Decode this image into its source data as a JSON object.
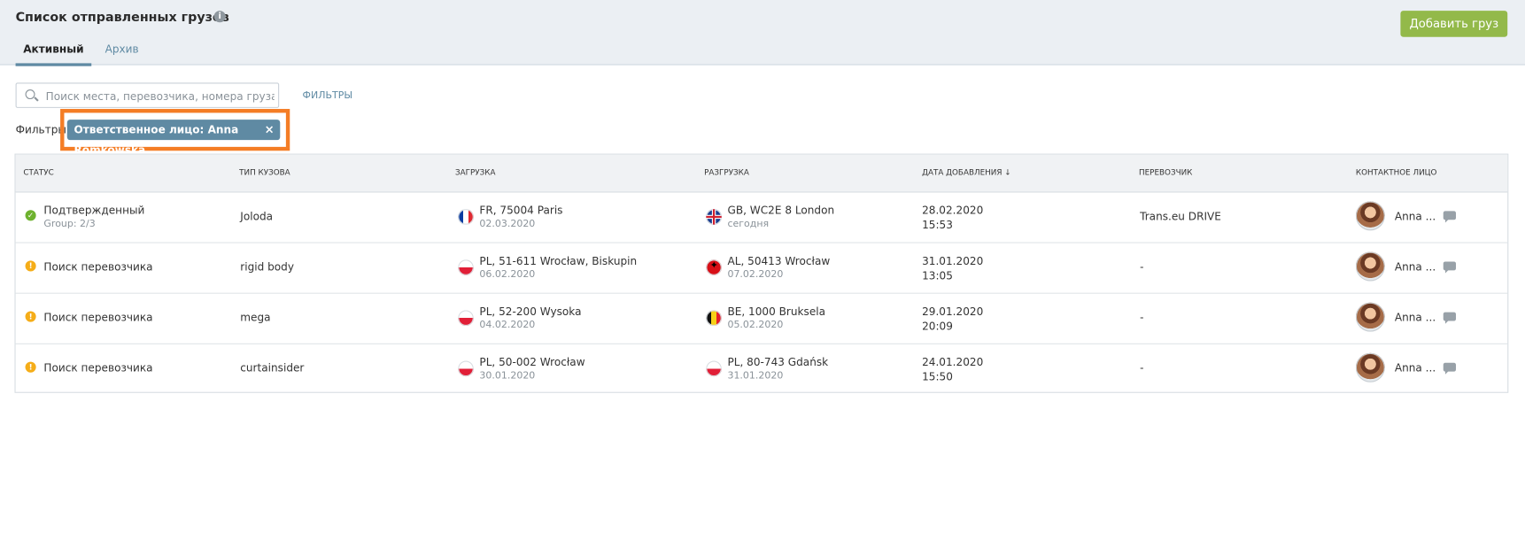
{
  "page": {
    "title": "Список отправленных грузов",
    "info_icon": "i",
    "add_button": "Добавить груз"
  },
  "tabs": [
    "Активный",
    "Архив"
  ],
  "search": {
    "placeholder": "Поиск места, перевозчика, номера груза ..."
  },
  "filters": {
    "link": "ФИЛЬТРЫ",
    "label": "Фильтры",
    "chip": "Ответственное лицо: Anna Romkowska",
    "remove": "×"
  },
  "table": {
    "headers": [
      "СТАТУС",
      "ТИП КУЗОВА",
      "ЗАГРУЗКА",
      "РАЗГРУЗКА",
      "ДАТА ДОБАВЛЕНИЯ ↓",
      "ПЕРЕВОЗЧИК",
      "КОНТАКТНОЕ ЛИЦО"
    ],
    "rows": [
      {
        "status_icon": "check-circle-icon",
        "status": "Подтвержденный",
        "status_sub": "Group: 2/3",
        "body_type": "Joloda",
        "loading": "FR, 75004 Paris",
        "loading_date": "02.03.2020",
        "loading_flag": "france-flag-icon",
        "unloading": "GB, WC2E 8 London",
        "unloading_date": "сегодня",
        "unloading_flag": "great-britain-flag-icon",
        "added_date": "28.02.2020",
        "added_time": "15:53",
        "carrier": "Trans.eu DRIVE",
        "contact": "Anna ..."
      },
      {
        "status_icon": "warning-circle-icon",
        "status": "Поиск перевозчика",
        "status_sub": "",
        "body_type": "rigid body",
        "loading": "PL, 51-611 Wrocław, Biskupin",
        "loading_date": "06.02.2020",
        "loading_flag": "poland-flag-icon",
        "unloading": "AL, 50413 Wrocław",
        "unloading_date": "07.02.2020",
        "unloading_flag": "albania-flag-icon",
        "added_date": "31.01.2020",
        "added_time": "13:05",
        "carrier": "-",
        "contact": "Anna ..."
      },
      {
        "status_icon": "warning-circle-icon",
        "status": "Поиск перевозчика",
        "status_sub": "",
        "body_type": "mega",
        "loading": "PL, 52-200 Wysoka",
        "loading_date": "04.02.2020",
        "loading_flag": "poland-flag-icon",
        "unloading": "BE, 1000 Bruksela",
        "unloading_date": "05.02.2020",
        "unloading_flag": "belgium-flag-icon",
        "added_date": "29.01.2020",
        "added_time": "20:09",
        "carrier": "-",
        "contact": "Anna ..."
      },
      {
        "status_icon": "warning-circle-icon",
        "status": "Поиск перевозчика",
        "status_sub": "",
        "body_type": "curtainsider",
        "loading": "PL, 50-002 Wrocław",
        "loading_date": "30.01.2020",
        "loading_flag": "poland-flag-icon",
        "unloading": "PL, 80-743 Gdańsk",
        "unloading_date": "31.01.2020",
        "unloading_flag": "poland-flag-icon",
        "added_date": "24.01.2020",
        "added_time": "15:50",
        "carrier": "-",
        "contact": "Anna ..."
      }
    ]
  },
  "colors": {
    "accent": "#5f8aa3",
    "success": "#6eb22f",
    "warning": "#f5ad18",
    "button": "#93b94a",
    "highlight": "#f47d25"
  }
}
